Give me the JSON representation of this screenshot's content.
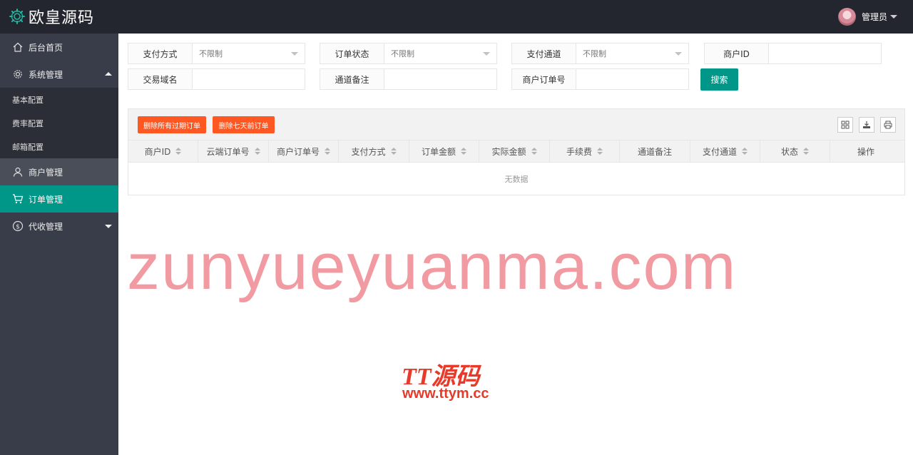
{
  "app": {
    "title": "欧皇源码"
  },
  "user": {
    "name": "管理员"
  },
  "sidebar": {
    "items": [
      {
        "label": "后台首页",
        "icon": "home-icon"
      },
      {
        "label": "系统管理",
        "icon": "gear-icon",
        "expanded": true,
        "children": [
          "基本配置",
          "费率配置",
          "邮箱配置"
        ]
      },
      {
        "label": "商户管理",
        "icon": "user-icon"
      },
      {
        "label": "订单管理",
        "icon": "cart-icon",
        "active": true
      },
      {
        "label": "代收管理",
        "icon": "dollar-icon"
      }
    ]
  },
  "filters": {
    "pay_method": {
      "label": "支付方式",
      "value": "不限制"
    },
    "order_status": {
      "label": "订单状态",
      "value": "不限制"
    },
    "pay_channel": {
      "label": "支付通道",
      "value": "不限制"
    },
    "merchant_id": {
      "label": "商户ID",
      "value": ""
    },
    "domain": {
      "label": "交易域名",
      "value": ""
    },
    "channel_note": {
      "label": "通道备注",
      "value": ""
    },
    "merchant_order_no": {
      "label": "商户订单号",
      "value": ""
    },
    "search_label": "搜索"
  },
  "table": {
    "actions": {
      "delete_expired": "删除所有过期订单",
      "delete_seven_days": "删除七天前订单"
    },
    "tools": [
      "columns-icon",
      "export-icon",
      "print-icon"
    ],
    "columns": [
      {
        "label": "商户ID",
        "sortable": true
      },
      {
        "label": "云端订单号",
        "sortable": true
      },
      {
        "label": "商户订单号",
        "sortable": true
      },
      {
        "label": "支付方式",
        "sortable": true
      },
      {
        "label": "订单金额",
        "sortable": true
      },
      {
        "label": "实际金额",
        "sortable": true
      },
      {
        "label": "手续费",
        "sortable": true
      },
      {
        "label": "通道备注",
        "sortable": false
      },
      {
        "label": "支付通道",
        "sortable": true
      },
      {
        "label": "状态",
        "sortable": true
      },
      {
        "label": "操作",
        "sortable": false
      }
    ],
    "empty_text": "无数据"
  },
  "watermarks": {
    "main": "zunyueyuanma.com",
    "brand": "TT源码",
    "url": "www.ttym.cc"
  },
  "colors": {
    "accent": "#009688",
    "danger": "#ff5722",
    "header_bg": "#23262e",
    "sidebar_bg": "#393d49"
  }
}
